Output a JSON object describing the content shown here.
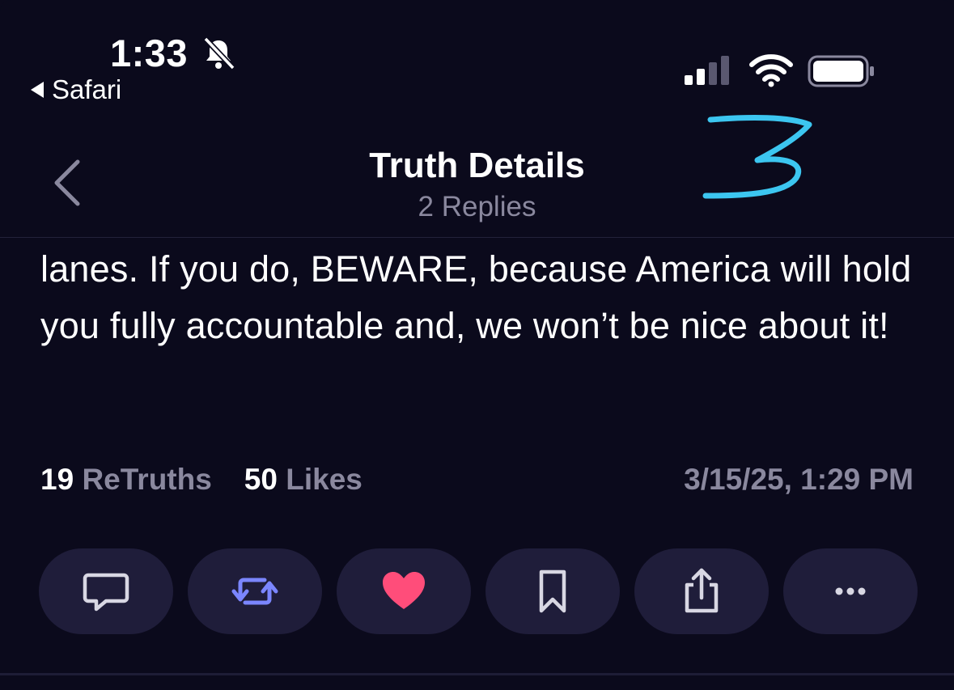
{
  "status_bar": {
    "time": "1:33",
    "back_app": "Safari"
  },
  "nav": {
    "title": "Truth Details",
    "subtitle": "2 Replies",
    "annotation": "3"
  },
  "post": {
    "text": "lanes. If you do, BEWARE, because America will hold you fully accountable and, we won’t be nice about it!"
  },
  "stats": {
    "retruths_count": "19",
    "retruths_label": "ReTruths",
    "likes_count": "50",
    "likes_label": "Likes",
    "timestamp": "3/15/25, 1:29 PM"
  },
  "actions": [
    {
      "icon": "reply-icon"
    },
    {
      "icon": "retruth-icon"
    },
    {
      "icon": "heart-icon"
    },
    {
      "icon": "bookmark-icon"
    },
    {
      "icon": "share-icon"
    },
    {
      "icon": "more-icon"
    }
  ],
  "colors": {
    "background": "#0b0a1c",
    "button_bg": "#1f1d3a",
    "muted_text": "#8a889e",
    "retruth_accent": "#7b86ff",
    "like_accent": "#ff4d7a",
    "annotation": "#3cc6f0"
  }
}
